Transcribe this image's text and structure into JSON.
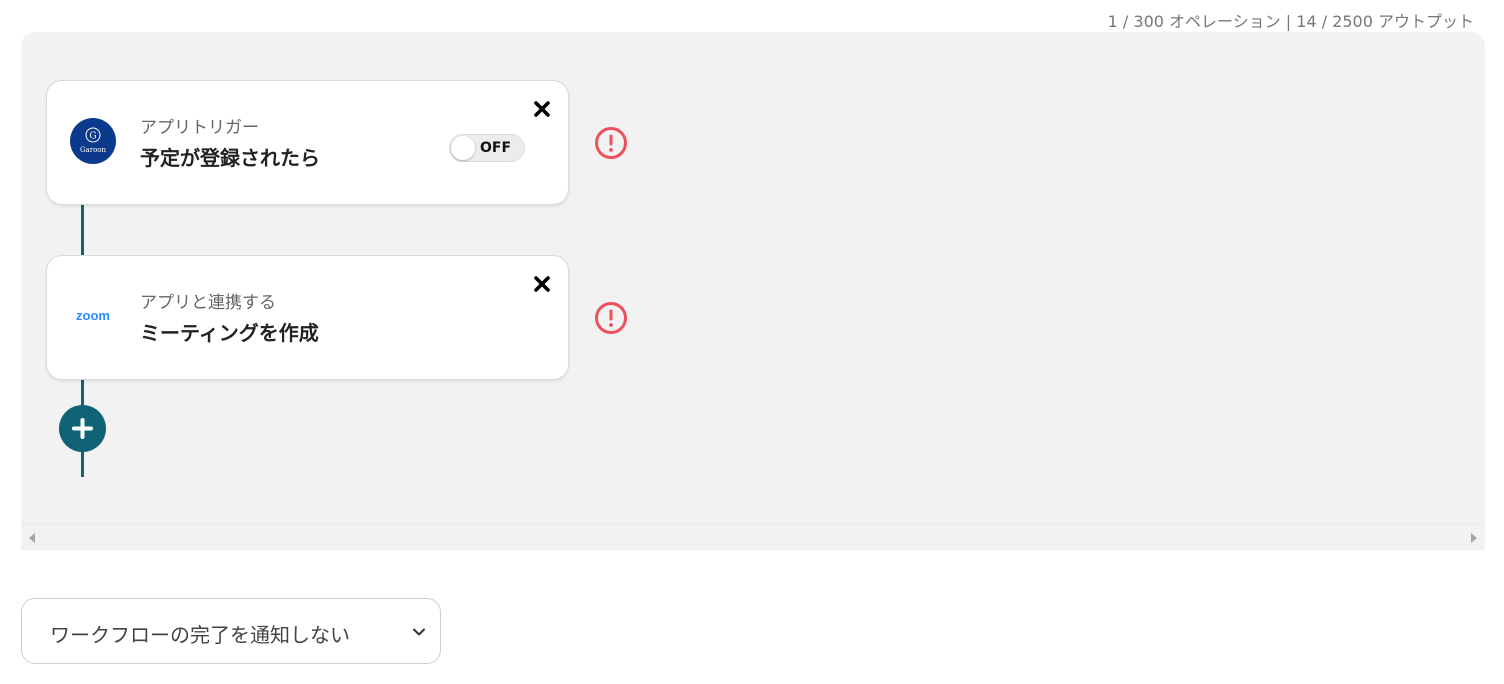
{
  "usage": {
    "text": "1 / 300 オペレーション | 14 / 2500 アウトプット"
  },
  "steps": [
    {
      "app_icon": "garoon-logo",
      "app_icon_letter": "G",
      "app_icon_text": "Garoon",
      "subtitle": "アプリトリガー",
      "title": "予定が登録されたら",
      "toggle_label": "OFF",
      "toggle_state": "off",
      "close_icon": "close-icon",
      "warning_icon": "exclamation-circle-icon"
    },
    {
      "app_icon": "zoom-logo",
      "app_icon_text": "zoom",
      "subtitle": "アプリと連携する",
      "title": "ミーティングを作成",
      "close_icon": "close-icon",
      "warning_icon": "exclamation-circle-icon"
    }
  ],
  "add_step": {
    "icon": "plus-icon"
  },
  "notify_select": {
    "selected": "ワークフローの完了を通知しない",
    "chevron_icon": "chevron-down-icon"
  },
  "colors": {
    "accent": "#0f6375",
    "warning": "#f0505a",
    "garoon_blue": "#0b3a8c",
    "zoom_blue": "#2d8cff",
    "canvas_bg": "#f2f2f2"
  }
}
